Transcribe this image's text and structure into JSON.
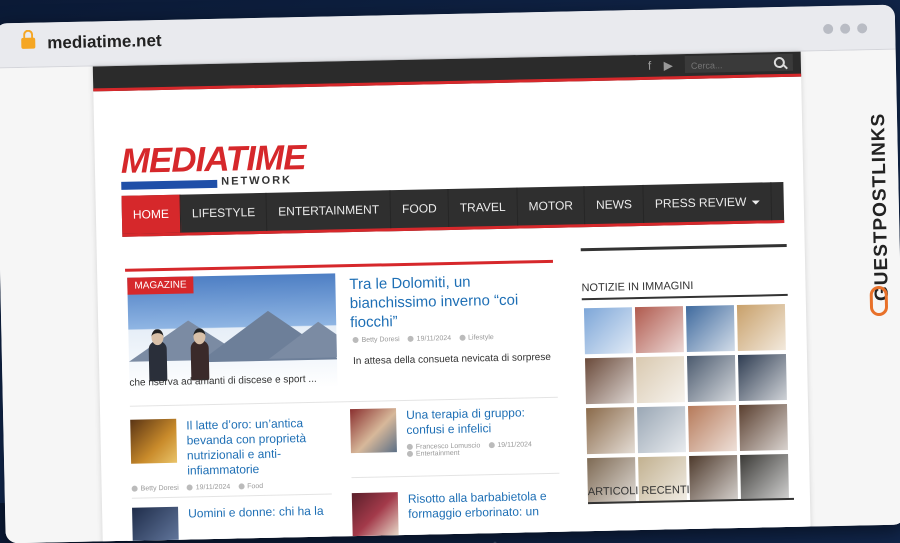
{
  "browser": {
    "url": "mediatime.net"
  },
  "topbar": {
    "search_placeholder": "Cerca..."
  },
  "logo": {
    "main": "MEDIATIME",
    "sub": "NETWORK"
  },
  "nav": {
    "items": [
      "HOME",
      "LIFESTYLE",
      "ENTERTAINMENT",
      "FOOD",
      "TRAVEL",
      "MOTOR",
      "NEWS",
      "PRESS REVIEW"
    ],
    "active": "HOME"
  },
  "featured": {
    "badge": "MAGAZINE",
    "title": "Tra le Dolomiti, un bianchissimo inverno “coi fiocchi”",
    "author": "Betty Doresi",
    "date": "19/11/2024",
    "category": "Lifestyle",
    "excerpt": "In attesa della consueta nevicata di sorprese che riserva ad amanti di discese e sport ..."
  },
  "posts": [
    {
      "title": "Il latte d’oro: un’antica bevanda con proprietà nutrizionali e anti-infiammatorie",
      "author": "Betty Doresi",
      "date": "19/11/2024",
      "category": "Food"
    },
    {
      "title": "Una terapia di gruppo: confusi e infelici",
      "author": "Francesco Lomuscio",
      "date": "19/11/2024",
      "category": "Entertainment"
    },
    {
      "title": "Uomini e donne: chi ha la",
      "author": "",
      "date": "",
      "category": ""
    },
    {
      "title": "Risotto alla barbabietola e formaggio erborinato: un",
      "author": "",
      "date": "",
      "category": ""
    }
  ],
  "sidebar": {
    "gallery_title": "NOTIZIE IN IMMAGINI",
    "recent_title": "ARTICOLI RECENTI",
    "gallery_colors": [
      "#7da6d8",
      "#b05a4e",
      "#3f6a9e",
      "#c8a06a",
      "#6a4a3a",
      "#d9c9b0",
      "#4b5a6e",
      "#2f3d52",
      "#8a6a4a",
      "#9aa7b5",
      "#b67a5a",
      "#5a3f2f",
      "#7e6a54",
      "#c2b190",
      "#4e3a2c",
      "#3b3a37"
    ]
  },
  "watermark": {
    "text": "GUESTPOSTLINKS"
  }
}
